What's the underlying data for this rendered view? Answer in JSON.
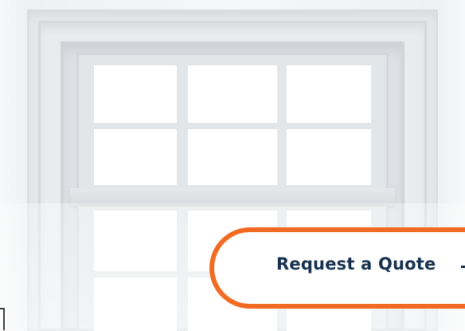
{
  "cta": {
    "label": "Request a Quote",
    "accent_color": "#f26b22",
    "text_color": "#16314f",
    "arrow_icon": "arrow-right-icon"
  },
  "hero": {
    "image": "white-double-hung-window"
  }
}
